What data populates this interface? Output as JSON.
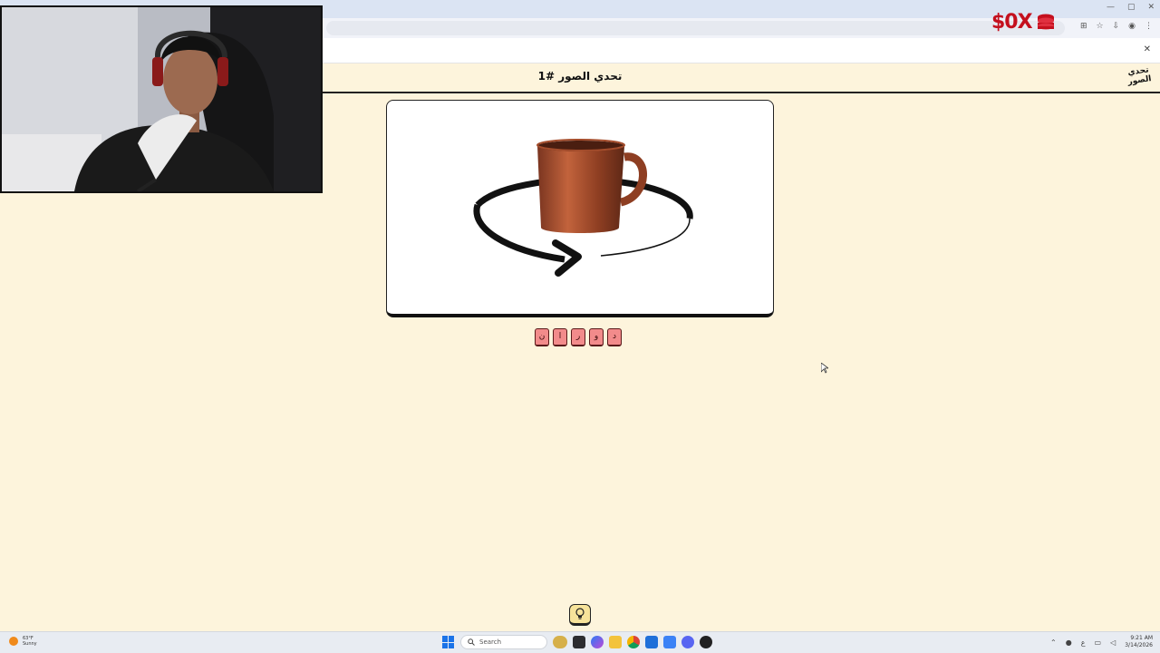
{
  "browser": {
    "window_controls": [
      "—",
      "▢",
      "✕"
    ],
    "toolbar_icons": [
      "⊞",
      "☆",
      "⇩",
      "◉",
      "⋮"
    ],
    "infobar_close": "✕"
  },
  "brand": {
    "text": "$0X"
  },
  "game": {
    "title": "تحدي الصور #1",
    "logo_text": "تحدي الصور"
  },
  "tiles": [
    "ن",
    "ا",
    "ر",
    "و",
    "د"
  ],
  "taskbar": {
    "weather_temp": "63°F",
    "weather_desc": "Sunny",
    "search_placeholder": "Search",
    "tray_lang": "ع",
    "clock_time": "9:21 AM",
    "clock_date": "3/14/2026"
  },
  "colors": {
    "page_bg": "#fdf4dc",
    "tile_fill": "#f28b8b",
    "brand_red": "#c4101e",
    "hint_fill": "#f7e39a"
  }
}
